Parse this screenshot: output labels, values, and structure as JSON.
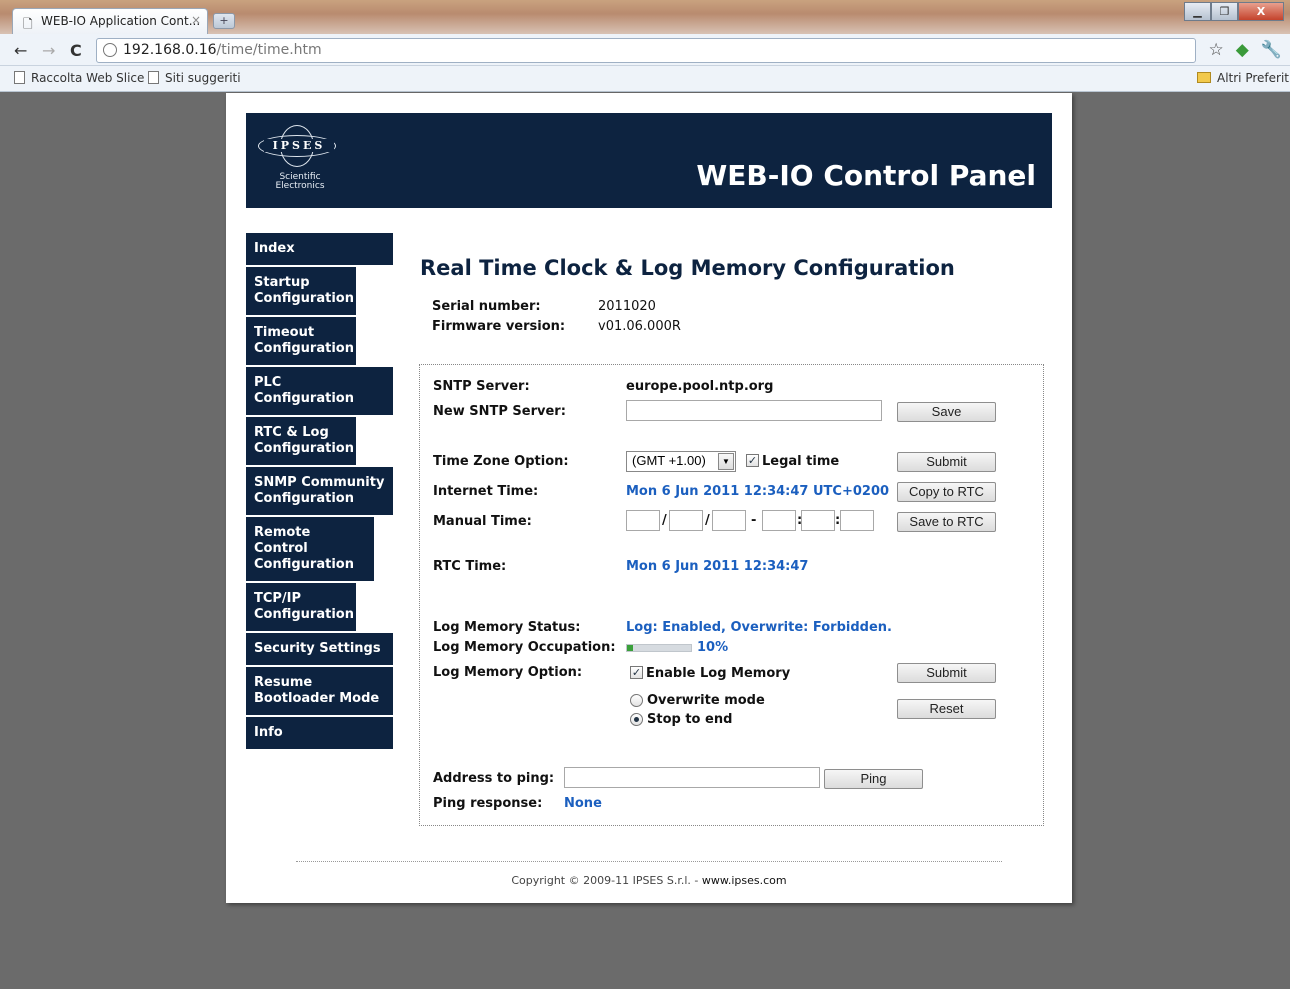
{
  "browser": {
    "tab_title": "WEB-IO Application Cont...",
    "tab_close": "×",
    "new_tab": "+",
    "url_host": "192.168.0.16",
    "url_path": "/time/time.htm",
    "bookmarks": [
      "Raccolta Web Slice",
      "Siti suggeriti"
    ],
    "other_bookmarks": "Altri Preferiti",
    "window_buttons": [
      "▁",
      "❐",
      "X"
    ]
  },
  "banner": {
    "logo_text": "IPSES",
    "logo_sub": "Scientific Electronics",
    "title": "WEB-IO Control Panel"
  },
  "nav": [
    "Index",
    "Startup Configuration",
    "Timeout Configuration",
    "PLC Configuration",
    "RTC & Log Configuration",
    "SNMP Community Configuration",
    "Remote Control Configuration",
    "TCP/IP Configuration",
    "Security Settings",
    "Resume Bootloader Mode",
    "Info"
  ],
  "content": {
    "title": "Real Time Clock & Log Memory Configuration",
    "serial_label": "Serial number:",
    "serial_value": "2011020",
    "firmware_label": "Firmware version:",
    "firmware_value": "v01.06.000R"
  },
  "form": {
    "sntp_label": "SNTP Server:",
    "sntp_value": "europe.pool.ntp.org",
    "new_sntp_label": "New SNTP Server:",
    "new_sntp_value": "",
    "save_button": "Save",
    "timezone_label": "Time Zone Option:",
    "timezone_selected": "(GMT +1.00)",
    "legal_time_label": "Legal time",
    "legal_time_checked": true,
    "submit_button": "Submit",
    "internet_time_label": "Internet Time:",
    "internet_time_value": "Mon 6 Jun 2011 12:34:47 UTC+0200",
    "copy_rtc_button": "Copy to RTC",
    "manual_time_label": "Manual Time:",
    "date_sep": "/",
    "datetime_sep": "-",
    "time_sep": ":",
    "save_rtc_button": "Save to RTC",
    "rtc_time_label": "RTC Time:",
    "rtc_time_value": "Mon 6 Jun 2011 12:34:47",
    "log_status_label": "Log Memory Status:",
    "log_status_value": "Log: Enabled, Overwrite: Forbidden.",
    "log_occupation_label": "Log Memory Occupation:",
    "log_occupation_value": "10%",
    "log_occupation_fraction": 0.1,
    "log_option_label": "Log Memory Option:",
    "enable_log_label": "Enable Log Memory",
    "enable_log_checked": true,
    "log_submit_button": "Submit",
    "overwrite_label": "Overwrite mode",
    "stop_label": "Stop to end",
    "reset_button": "Reset",
    "ping_label": "Address to ping:",
    "ping_value": "",
    "ping_button": "Ping",
    "ping_response_label": "Ping response:",
    "ping_response_value": "None"
  },
  "footer": {
    "copyright": "Copyright © 2009-11 IPSES S.r.l. - ",
    "website": "www.ipses.com"
  },
  "colors": {
    "banner": "#0d2340",
    "accent_blue": "#1b5fbf",
    "progress_fill": "#3aa03a"
  }
}
